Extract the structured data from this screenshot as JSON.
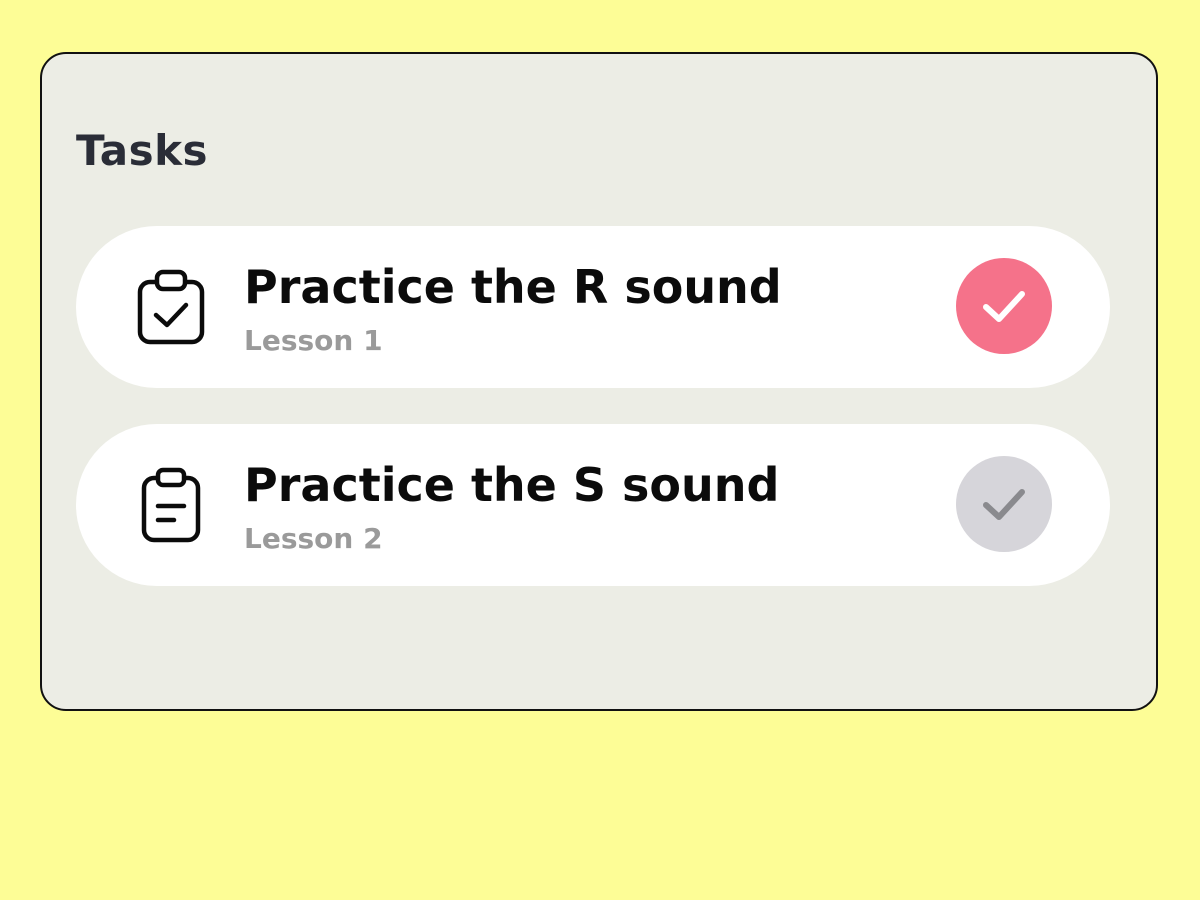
{
  "header": {
    "title": "Tasks"
  },
  "tasks": [
    {
      "title": "Practice the R sound",
      "lesson": "Lesson 1",
      "icon": "clipboard-check-icon",
      "completed": true,
      "check_color": "#f5728a"
    },
    {
      "title": "Practice the S sound",
      "lesson": "Lesson 2",
      "icon": "clipboard-list-icon",
      "completed": false,
      "check_color": "#d6d5da"
    }
  ],
  "colors": {
    "background": "#fdfd96",
    "panel": "#ecede5",
    "card": "#ffffff",
    "title_text": "#2a2d37",
    "lesson_text": "#9a9a9a",
    "accent_pink": "#f5728a",
    "muted_gray": "#d6d5da"
  }
}
